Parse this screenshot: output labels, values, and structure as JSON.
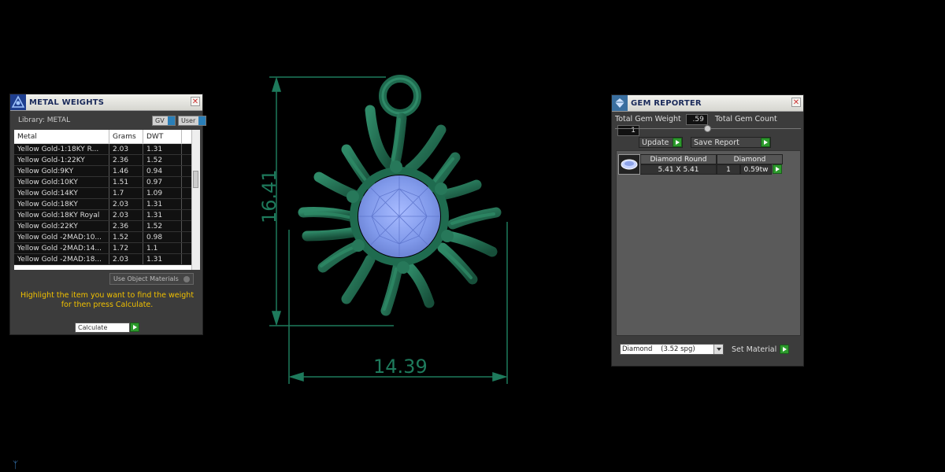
{
  "metal_weights": {
    "title": "METAL WEIGHTS",
    "library_label": "Library: METAL",
    "gv_label": "GV",
    "user_label": "User",
    "columns": [
      "Metal",
      "Grams",
      "DWT"
    ],
    "rows": [
      [
        "Yellow Gold-1:18KY R...",
        "2.03",
        "1.31"
      ],
      [
        "Yellow Gold-1:22KY",
        "2.36",
        "1.52"
      ],
      [
        "Yellow Gold:9KY",
        "1.46",
        "0.94"
      ],
      [
        "Yellow Gold:10KY",
        "1.51",
        "0.97"
      ],
      [
        "Yellow Gold:14KY",
        "1.7",
        "1.09"
      ],
      [
        "Yellow Gold:18KY",
        "2.03",
        "1.31"
      ],
      [
        "Yellow Gold:18KY Royal",
        "2.03",
        "1.31"
      ],
      [
        "Yellow Gold:22KY",
        "2.36",
        "1.52"
      ],
      [
        "Yellow Gold -2MAD:10...",
        "1.52",
        "0.98"
      ],
      [
        "Yellow Gold -2MAD:14...",
        "1.72",
        "1.1"
      ],
      [
        "Yellow Gold -2MAD:18...",
        "2.03",
        "1.31"
      ]
    ],
    "use_object_materials": "Use Object Materials",
    "hint_line1": "Highlight the item you want to find the weight",
    "hint_line2": "for then press Calculate.",
    "calculate_label": "Calculate"
  },
  "gem_reporter": {
    "title": "GEM REPORTER",
    "total_weight_label": "Total Gem Weight",
    "total_weight_value": ".59",
    "total_count_label": "Total Gem Count",
    "total_count_value": "1",
    "update_label": "Update",
    "save_report_label": "Save Report",
    "gem": {
      "shape": "Diamond Round",
      "material": "Diamond",
      "size": "5.41 X 5.41",
      "count": "1",
      "weight": "0.59tw"
    },
    "material_select": "Diamond    (3.52 spg)",
    "set_material_label": "Set Material"
  },
  "viewport": {
    "height_dimension": "16.41",
    "width_dimension": "14.39"
  },
  "colors": {
    "model_green": "#1f6b4f",
    "gem_blue": "#8fa6f0",
    "dimension_green": "#1e7a5c",
    "hint_yellow": "#f0c000"
  }
}
